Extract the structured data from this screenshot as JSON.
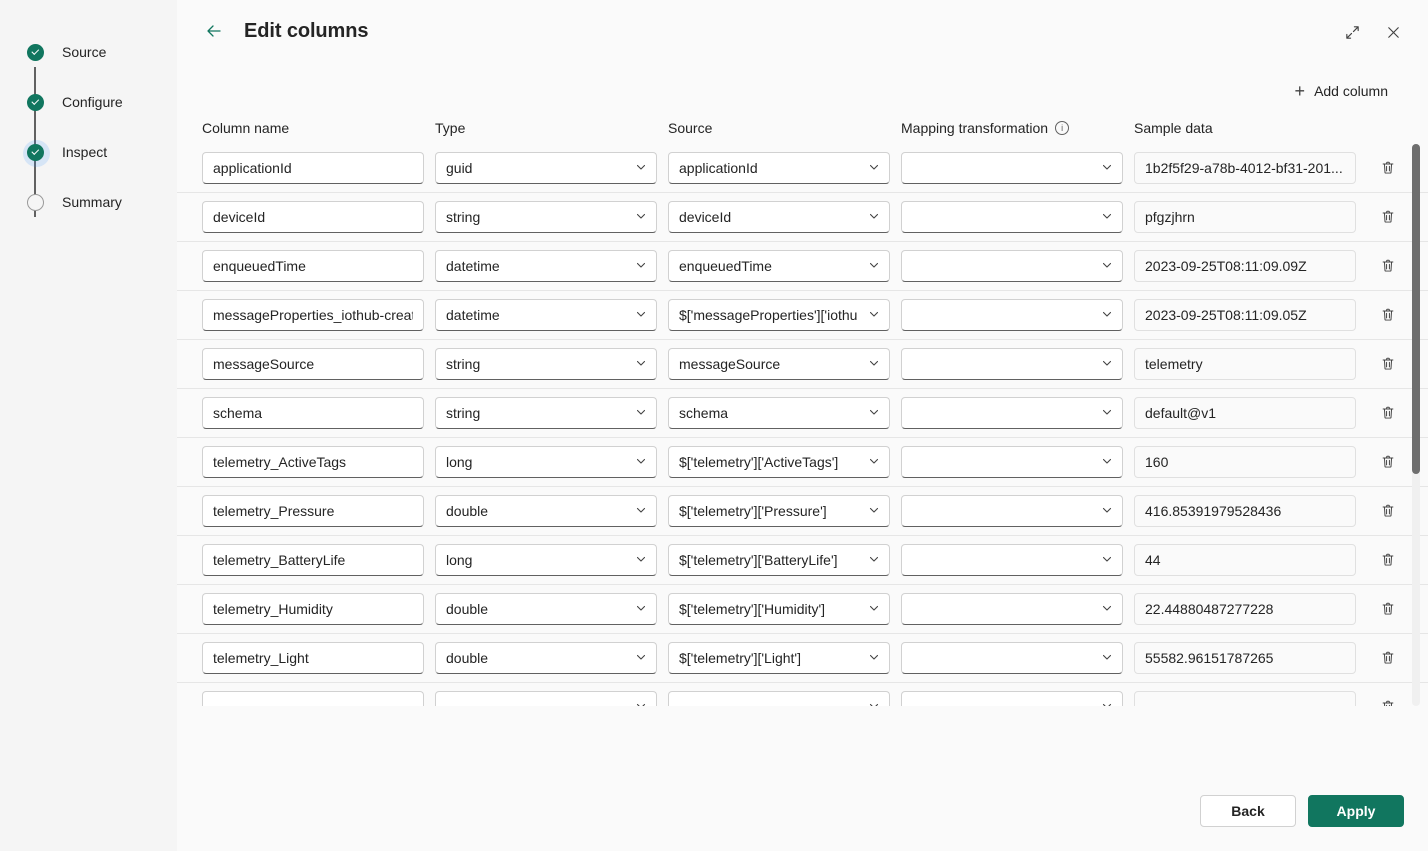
{
  "sidebar": {
    "steps": [
      {
        "label": "Source",
        "state": "done"
      },
      {
        "label": "Configure",
        "state": "done"
      },
      {
        "label": "Inspect",
        "state": "current"
      },
      {
        "label": "Summary",
        "state": "pending"
      }
    ]
  },
  "header": {
    "title": "Edit columns",
    "back_icon": "arrow-left-icon",
    "expand_icon": "expand-diagonal-icon",
    "close_icon": "close-icon"
  },
  "toolbar": {
    "add_column_label": "Add column",
    "add_icon": "plus-icon"
  },
  "table": {
    "headers": {
      "column_name": "Column name",
      "type": "Type",
      "source": "Source",
      "mapping_transformation": "Mapping transformation",
      "mapping_info_icon": "info-icon",
      "sample_data": "Sample data"
    },
    "delete_icon": "trash-icon",
    "rows": [
      {
        "name": "applicationId",
        "type": "guid",
        "source": "applicationId",
        "mapping": "",
        "sample": "1b2f5f29-a78b-4012-bf31-201..."
      },
      {
        "name": "deviceId",
        "type": "string",
        "source": "deviceId",
        "mapping": "",
        "sample": "pfgzjhrn"
      },
      {
        "name": "enqueuedTime",
        "type": "datetime",
        "source": "enqueuedTime",
        "mapping": "",
        "sample": "2023-09-25T08:11:09.09Z"
      },
      {
        "name": "messageProperties_iothub-creat",
        "type": "datetime",
        "source": "$['messageProperties']['iothu",
        "mapping": "",
        "sample": "2023-09-25T08:11:09.05Z"
      },
      {
        "name": "messageSource",
        "type": "string",
        "source": "messageSource",
        "mapping": "",
        "sample": "telemetry"
      },
      {
        "name": "schema",
        "type": "string",
        "source": "schema",
        "mapping": "",
        "sample": "default@v1"
      },
      {
        "name": "telemetry_ActiveTags",
        "type": "long",
        "source": "$['telemetry']['ActiveTags']",
        "mapping": "",
        "sample": "160"
      },
      {
        "name": "telemetry_Pressure",
        "type": "double",
        "source": "$['telemetry']['Pressure']",
        "mapping": "",
        "sample": "416.85391979528436"
      },
      {
        "name": "telemetry_BatteryLife",
        "type": "long",
        "source": "$['telemetry']['BatteryLife']",
        "mapping": "",
        "sample": "44"
      },
      {
        "name": "telemetry_Humidity",
        "type": "double",
        "source": "$['telemetry']['Humidity']",
        "mapping": "",
        "sample": "22.44880487277228"
      },
      {
        "name": "telemetry_Light",
        "type": "double",
        "source": "$['telemetry']['Light']",
        "mapping": "",
        "sample": "55582.96151787265"
      },
      {
        "name": "",
        "type": "",
        "source": "",
        "mapping": "",
        "sample": ""
      }
    ]
  },
  "footer": {
    "back_label": "Back",
    "apply_label": "Apply"
  },
  "colors": {
    "accent": "#11765f",
    "sidebar_bg": "#f5f5f5",
    "panel_bg": "#fafafa",
    "text": "#242424"
  }
}
